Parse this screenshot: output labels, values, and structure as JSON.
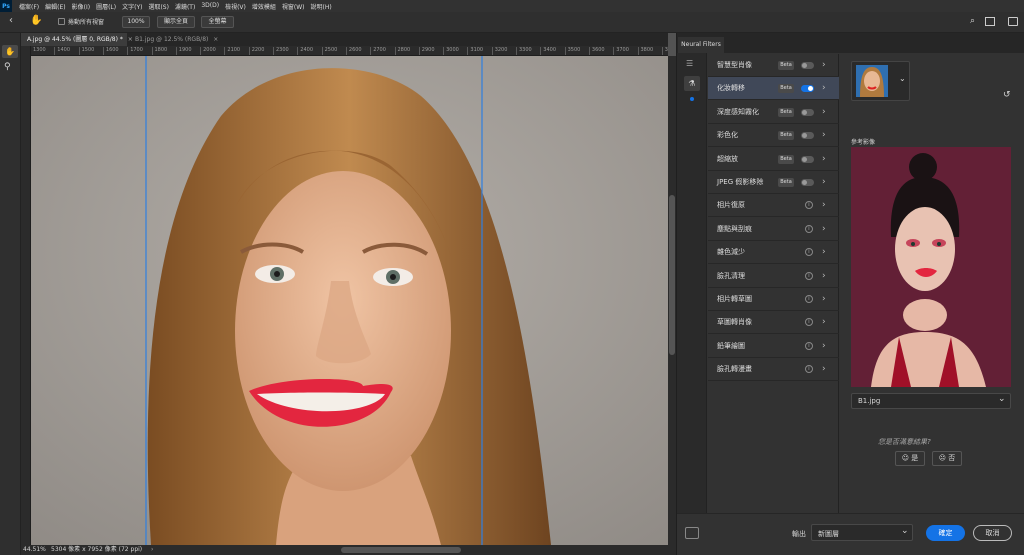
{
  "app": {
    "logo": "Ps"
  },
  "menu": [
    "檔案(F)",
    "編輯(E)",
    "影像(I)",
    "圖層(L)",
    "文字(Y)",
    "選取(S)",
    "濾鏡(T)",
    "3D(D)",
    "檢視(V)",
    "增效模組",
    "視窗(W)",
    "說明(H)"
  ],
  "options": {
    "scroll_all_label": "捲動所有視窗",
    "zoom_100": "100%",
    "fit_screen": "顯示全頁",
    "fill_screen": "全螢幕"
  },
  "tabs": [
    {
      "label": "A.jpg @ 44.5% (圖層 0, RGB/8) *",
      "active": true
    },
    {
      "label": "B1.jpg @ 12.5% (RGB/8)",
      "active": false
    }
  ],
  "ruler_ticks": [
    "1300",
    "1400",
    "1500",
    "1600",
    "1700",
    "1800",
    "1900",
    "2000",
    "2100",
    "2200",
    "2300",
    "2400",
    "2500",
    "2600",
    "2700",
    "2800",
    "2900",
    "3000",
    "3100",
    "3200",
    "3300",
    "3400",
    "3500",
    "3600",
    "3700",
    "3800",
    "3900"
  ],
  "status": {
    "zoom": "44.51%",
    "doc_info": "5304 像素 x 7952 像素 (72 ppi)"
  },
  "neural": {
    "panel_title": "Neural Filters",
    "filters": [
      {
        "name": "智慧型肖像",
        "beta": "Beta",
        "kind": "toggle",
        "on": false,
        "active": false
      },
      {
        "name": "化妝轉移",
        "beta": "Beta",
        "kind": "toggle",
        "on": true,
        "active": true
      },
      {
        "name": "深度感知霧化",
        "beta": "Beta",
        "kind": "toggle",
        "on": false,
        "active": false
      },
      {
        "name": "彩色化",
        "beta": "Beta",
        "kind": "toggle",
        "on": false,
        "active": false
      },
      {
        "name": "超縮放",
        "beta": "Beta",
        "kind": "toggle",
        "on": false,
        "active": false
      },
      {
        "name": "JPEG 假影移除",
        "beta": "Beta",
        "kind": "toggle",
        "on": false,
        "active": false
      },
      {
        "name": "相片復原",
        "beta": "",
        "kind": "info",
        "on": false,
        "active": false
      },
      {
        "name": "塵點與刮痕",
        "beta": "",
        "kind": "info",
        "on": false,
        "active": false
      },
      {
        "name": "雜色減少",
        "beta": "",
        "kind": "info",
        "on": false,
        "active": false
      },
      {
        "name": "臉孔清理",
        "beta": "",
        "kind": "info",
        "on": false,
        "active": false
      },
      {
        "name": "相片轉草圖",
        "beta": "",
        "kind": "info",
        "on": false,
        "active": false
      },
      {
        "name": "草圖轉肖像",
        "beta": "",
        "kind": "info",
        "on": false,
        "active": false
      },
      {
        "name": "鉛筆繪圖",
        "beta": "",
        "kind": "info",
        "on": false,
        "active": false
      },
      {
        "name": "臉孔轉漫畫",
        "beta": "",
        "kind": "info",
        "on": false,
        "active": false
      }
    ],
    "reference_label": "參考影像",
    "reference_file": "B1.jpg",
    "feedback_question": "您是否滿意結果?",
    "feedback_yes": "是",
    "feedback_no": "否",
    "output_label": "輸出",
    "output_value": "新圖層",
    "ok_label": "確定",
    "cancel_label": "取消"
  },
  "colors": {
    "accent": "#1473e6",
    "guide": "#2f7fe0",
    "lips": "#e3263f"
  }
}
